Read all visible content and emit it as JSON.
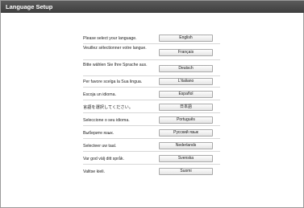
{
  "window": {
    "title": "Language Setup"
  },
  "languages": [
    {
      "prompt": "Please select your language.",
      "button": "English"
    },
    {
      "prompt": "Veuillez sélectionner votre langue.",
      "button": "Français"
    },
    {
      "prompt": "Bitte wählen Sie Ihre Sprache aus.",
      "button": "Deutsch"
    },
    {
      "prompt": "Per favore scelga la Sua lingua.",
      "button": "L'italiano"
    },
    {
      "prompt": "Escoja un idioma.",
      "button": "Español"
    },
    {
      "prompt": "言語を選択してください。",
      "button": "日本語"
    },
    {
      "prompt": "Seleccione o seu idioma.",
      "button": "Português"
    },
    {
      "prompt": "Выберите язык.",
      "button": "Русский язык"
    },
    {
      "prompt": "Selecteer uw taal.",
      "button": "Nederlands"
    },
    {
      "prompt": "Var god välj ditt språk.",
      "button": "Svenska"
    },
    {
      "prompt": "Valitse kieli.",
      "button": "Suomi"
    }
  ]
}
